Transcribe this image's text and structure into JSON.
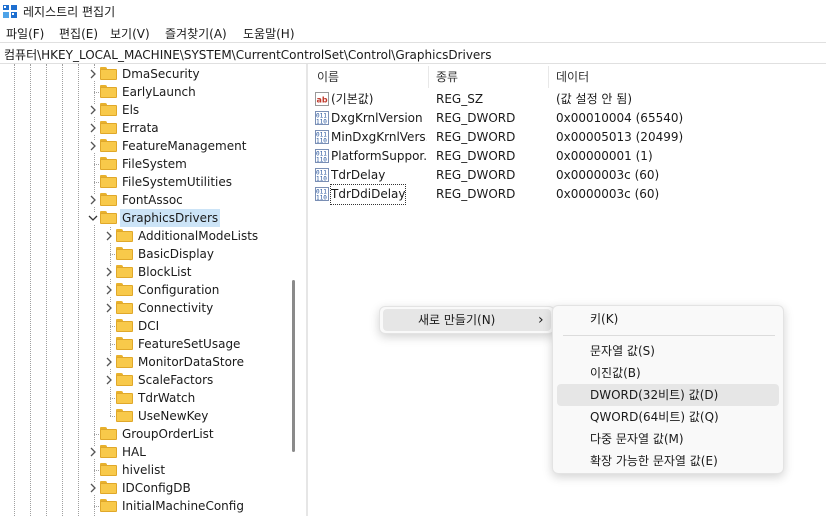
{
  "window": {
    "title": "레지스트리 편집기",
    "icon": "registry-editor-icon"
  },
  "menubar": [
    "파일(F)",
    "편집(E)",
    "보기(V)",
    "즐겨찾기(A)",
    "도움말(H)"
  ],
  "address": "컴퓨터\\HKEY_LOCAL_MACHINE\\SYSTEM\\CurrentControlSet\\Control\\GraphicsDrivers",
  "tree": {
    "level1": [
      {
        "label": "DmaSecurity",
        "expander": "chevron-right-icon"
      },
      {
        "label": "EarlyLaunch",
        "expander": ""
      },
      {
        "label": "Els",
        "expander": "chevron-right-icon"
      },
      {
        "label": "Errata",
        "expander": "chevron-right-icon"
      },
      {
        "label": "FeatureManagement",
        "expander": "chevron-right-icon"
      },
      {
        "label": "FileSystem",
        "expander": ""
      },
      {
        "label": "FileSystemUtilities",
        "expander": ""
      },
      {
        "label": "FontAssoc",
        "expander": "chevron-right-icon"
      },
      {
        "label": "GraphicsDrivers",
        "expander": "chevron-down-icon",
        "selected": true
      }
    ],
    "level2": [
      {
        "label": "AdditionalModeLists",
        "expander": "chevron-right-icon"
      },
      {
        "label": "BasicDisplay",
        "expander": ""
      },
      {
        "label": "BlockList",
        "expander": "chevron-right-icon"
      },
      {
        "label": "Configuration",
        "expander": "chevron-right-icon"
      },
      {
        "label": "Connectivity",
        "expander": "chevron-right-icon"
      },
      {
        "label": "DCI",
        "expander": ""
      },
      {
        "label": "FeatureSetUsage",
        "expander": ""
      },
      {
        "label": "MonitorDataStore",
        "expander": "chevron-right-icon"
      },
      {
        "label": "ScaleFactors",
        "expander": "chevron-right-icon"
      },
      {
        "label": "TdrWatch",
        "expander": ""
      },
      {
        "label": "UseNewKey",
        "expander": ""
      }
    ],
    "level1_after": [
      {
        "label": "GroupOrderList",
        "expander": ""
      },
      {
        "label": "HAL",
        "expander": "chevron-right-icon"
      },
      {
        "label": "hivelist",
        "expander": ""
      },
      {
        "label": "IDConfigDB",
        "expander": "chevron-right-icon"
      },
      {
        "label": "InitialMachineConfig",
        "expander": ""
      }
    ]
  },
  "list": {
    "columns": [
      "이름",
      "종류",
      "데이터"
    ],
    "rows": [
      {
        "name": "(기본값)",
        "type": "REG_SZ",
        "data": "(값 설정 안 됨)",
        "icon": "string-value-icon"
      },
      {
        "name": "DxgKrnlVersion",
        "type": "REG_DWORD",
        "data": "0x00010004 (65540)",
        "icon": "binary-value-icon"
      },
      {
        "name": "MinDxgKrnlVers...",
        "type": "REG_DWORD",
        "data": "0x00005013 (20499)",
        "icon": "binary-value-icon"
      },
      {
        "name": "PlatformSuppor...",
        "type": "REG_DWORD",
        "data": "0x00000001 (1)",
        "icon": "binary-value-icon"
      },
      {
        "name": "TdrDelay",
        "type": "REG_DWORD",
        "data": "0x0000003c (60)",
        "icon": "binary-value-icon"
      },
      {
        "name": "TdrDdiDelay",
        "type": "REG_DWORD",
        "data": "0x0000003c (60)",
        "icon": "binary-value-icon",
        "focused": true
      }
    ]
  },
  "context_menu": {
    "new_label": "새로 만들기(N)",
    "arrow": "›"
  },
  "submenu": {
    "items": [
      "키(K)",
      "문자열 값(S)",
      "이진값(B)",
      "DWORD(32비트) 값(D)",
      "QWORD(64비트) 값(Q)",
      "다중 문자열 값(M)",
      "확장 가능한 문자열 값(E)"
    ],
    "highlighted_index": 3
  },
  "colors": {
    "folder": "#f8c94a",
    "selection": "#cce4f7",
    "menu_hover": "#e6e6e6",
    "app_icon_blue": "#1e6fd0"
  }
}
